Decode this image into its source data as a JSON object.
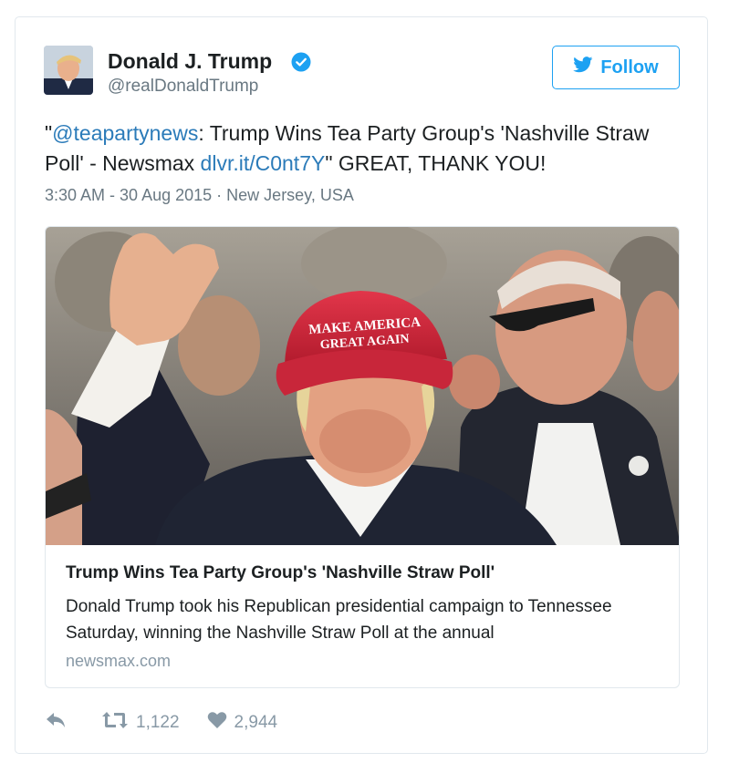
{
  "tweet": {
    "author_name": "Donald J. Trump",
    "author_handle": "@realDonaldTrump",
    "follow_label": "Follow",
    "text": {
      "open_quote": "\"",
      "mention": "@teapartynews",
      "part1": ": Trump Wins Tea Party Group's 'Nashville Straw Poll' - Newsmax ",
      "link": "dlvr.it/C0nt7Y",
      "part2": "\" GREAT, THANK YOU!"
    },
    "timestamp": "3:30 AM - 30 Aug 2015",
    "separator": "·",
    "location": "New Jersey, USA"
  },
  "card": {
    "image_caption_cap_line1": "MAKE AMERICA",
    "image_caption_cap_line2": "GREAT AGAIN",
    "title": "Trump Wins Tea Party Group's 'Nashville Straw Poll'",
    "description": "Donald Trump took his Republican presidential campaign to Tennessee Saturday, winning the Nashville Straw Poll at the annual",
    "domain": "newsmax.com"
  },
  "actions": {
    "retweets": "1,122",
    "likes": "2,944"
  },
  "colors": {
    "brand_blue": "#1da1f2",
    "link_blue": "#2b7bb9",
    "muted": "#697882",
    "cap_red": "#d7263d"
  },
  "icons": [
    "avatar",
    "verified-badge-icon",
    "twitter-bird-icon",
    "reply-icon",
    "retweet-icon",
    "heart-icon"
  ]
}
